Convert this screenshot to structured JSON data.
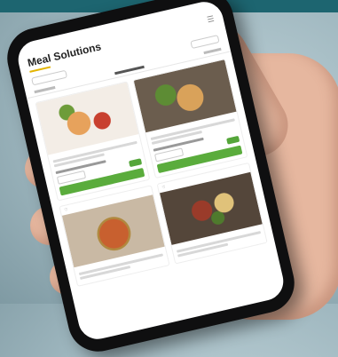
{
  "colors": {
    "teal_bar": "#1d6570",
    "accent_yellow": "#e3b400",
    "add_green": "#5aac3c",
    "background": "#a8bec5"
  },
  "app": {
    "title": "Meal Solutions"
  },
  "cards": [
    {
      "id": "a",
      "image": "salad-and-pasta-platter"
    },
    {
      "id": "b",
      "image": "wraps-and-salad-plate"
    },
    {
      "id": "c",
      "image": "pizza"
    },
    {
      "id": "d",
      "image": "sausage-and-sides-plate"
    }
  ]
}
